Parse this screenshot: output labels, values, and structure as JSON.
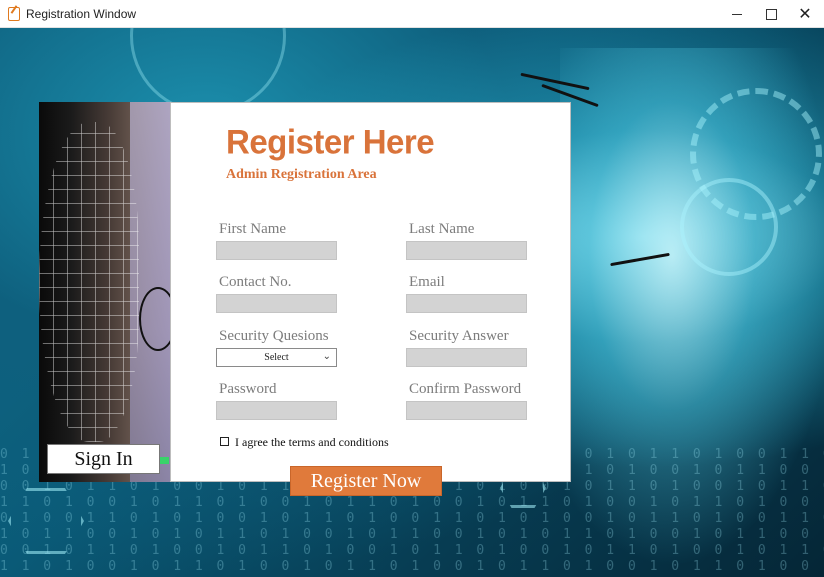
{
  "window": {
    "title": "Registration Window",
    "controls": {
      "minimize": "—",
      "maximize": "☐",
      "close": "✕"
    }
  },
  "side": {
    "signin_label": "Sign In"
  },
  "form": {
    "heading": "Register Here",
    "subheading": "Admin Registration Area",
    "fields": {
      "first_name": {
        "label": "First Name",
        "value": ""
      },
      "last_name": {
        "label": "Last Name",
        "value": ""
      },
      "contact": {
        "label": "Contact No.",
        "value": ""
      },
      "email": {
        "label": "Email",
        "value": ""
      },
      "security_question": {
        "label": "Security Quesions",
        "selected": "Select"
      },
      "security_answer": {
        "label": "Security Answer",
        "value": ""
      },
      "password": {
        "label": "Password",
        "value": ""
      },
      "confirm_password": {
        "label": "Confirm Password",
        "value": ""
      }
    },
    "agree_label": "I agree the terms and conditions",
    "agree_checked": false,
    "register_label": "Register Now"
  },
  "colors": {
    "accent": "#d9733a",
    "button": "#e07a3b",
    "field_bg": "#d3d3d3",
    "label": "#7c7c7c",
    "background": "#0a5a77"
  },
  "icons": {
    "app": "app-icon",
    "dropdown": "chevron-down-icon"
  }
}
